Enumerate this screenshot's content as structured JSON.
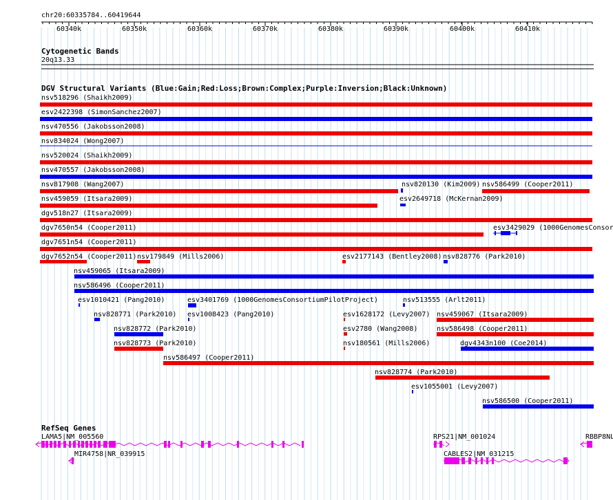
{
  "ruler": {
    "location": "chr20:60335784..60419644",
    "ticks": [
      "60340k",
      "60350k",
      "60360k",
      "60370k",
      "60380k",
      "60390k",
      "60400k",
      "60410k"
    ]
  },
  "cytoband": {
    "title": "Cytogenetic Bands",
    "band": "20q13.33"
  },
  "dgv": {
    "title": "DGV Structural Variants (Blue:Gain;Red:Loss;Brown:Complex;Purple:Inversion;Black:Unknown)",
    "colors": {
      "gain": "#0000ee",
      "loss": "#ee0000"
    },
    "variants": [
      {
        "label": "nsv518296 (Shaikh2009)",
        "type": "loss"
      },
      {
        "label": "esv2422398 (SimonSanchez2007)",
        "type": "gain"
      },
      {
        "label": "nsv470556 (Jakobsson2008)",
        "type": "loss"
      },
      {
        "label": "nsv834024 (Wong2007)",
        "type": "gain"
      },
      {
        "label": "nsv520024 (Shaikh2009)",
        "type": "loss"
      },
      {
        "label": "nsv470557 (Jakobsson2008)",
        "type": "gain"
      },
      {
        "label": "nsv817908 (Wang2007)",
        "type": "loss"
      },
      {
        "label": "nsv820130 (Kim2009)",
        "type": "gain"
      },
      {
        "label": "nsv586499 (Cooper2011)",
        "type": "loss"
      },
      {
        "label": "nsv459059 (Itsara2009)",
        "type": "loss"
      },
      {
        "label": "esv2649718 (McKernan2009)",
        "type": "gain"
      },
      {
        "label": "dgv518n27 (Itsara2009)",
        "type": "loss"
      },
      {
        "label": "dgv7650n54 (Cooper2011)",
        "type": "loss"
      },
      {
        "label": "esv3429029 (1000GenomesConsor",
        "type": "gain"
      },
      {
        "label": "dgv7651n54 (Cooper2011)",
        "type": "loss"
      },
      {
        "label": "dgv7652n54 (Cooper2011)",
        "type": "loss"
      },
      {
        "label": "nsv179849 (Mills2006)",
        "type": "loss"
      },
      {
        "label": "esv2177143 (Bentley2008)",
        "type": "loss"
      },
      {
        "label": "nsv828776 (Park2010)",
        "type": "gain"
      },
      {
        "label": "nsv459065 (Itsara2009)",
        "type": "gain"
      },
      {
        "label": "nsv586496 (Cooper2011)",
        "type": "gain"
      },
      {
        "label": "esv1010421 (Pang2010)",
        "type": "gain"
      },
      {
        "label": "esv3401769 (1000GenomesConsortiumPilotProject)",
        "type": "gain"
      },
      {
        "label": "nsv513555 (Arlt2011)",
        "type": "gain"
      },
      {
        "label": "nsv828771 (Park2010)",
        "type": "gain"
      },
      {
        "label": "esv1008423 (Pang2010)",
        "type": "gain"
      },
      {
        "label": "esv1628172 (Levy2007)",
        "type": "loss"
      },
      {
        "label": "nsv459067 (Itsara2009)",
        "type": "loss"
      },
      {
        "label": "nsv828772 (Park2010)",
        "type": "gain"
      },
      {
        "label": "esv2780 (Wang2008)",
        "type": "loss"
      },
      {
        "label": "nsv586498 (Cooper2011)",
        "type": "loss"
      },
      {
        "label": "nsv828773 (Park2010)",
        "type": "loss"
      },
      {
        "label": "nsv180561 (Mills2006)",
        "type": "loss"
      },
      {
        "label": "dgv4343n100 (Coe2014)",
        "type": "gain"
      },
      {
        "label": "nsv586497 (Cooper2011)",
        "type": "loss"
      },
      {
        "label": "nsv828774 (Park2010)",
        "type": "loss"
      },
      {
        "label": "esv1055001 (Levy2007)",
        "type": "gain"
      },
      {
        "label": "nsv586500 (Cooper2011)",
        "type": "gain"
      }
    ]
  },
  "refseq": {
    "title": "RefSeq Genes",
    "color": "#ee00ee",
    "genes": [
      {
        "label": "LAMA5|NM_005560"
      },
      {
        "label": "MIR4758|NR_039915"
      },
      {
        "label": "RPS21|NM_001024"
      },
      {
        "label": "CABLES2|NM_031215"
      },
      {
        "label": "RBBP8NL"
      }
    ]
  }
}
